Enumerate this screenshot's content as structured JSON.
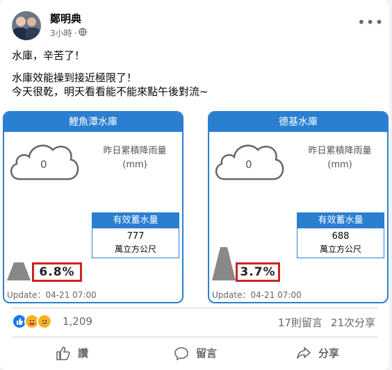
{
  "post": {
    "author": "鄭明典",
    "time": "3小時",
    "dot": "·",
    "privacy_icon": "globe-icon",
    "more_icon": "more-icon",
    "lines": [
      "水庫，辛苦了！",
      "水庫效能操到接近極限了！",
      "今天很乾，明天看看能不能來點午後對流~"
    ]
  },
  "panels": [
    {
      "title": "鯉魚潭水庫",
      "rain_value": "0",
      "rain_label": "昨日累積降雨量",
      "rain_unit": "(mm)",
      "storage_label": "有效蓄水量",
      "storage_value": "777",
      "storage_unit": "萬立方公尺",
      "percent": "6.8%",
      "percent_value": 6.8,
      "update": "Update：04-21 07:00"
    },
    {
      "title": "德基水庫",
      "rain_value": "0",
      "rain_label": "昨日累積降雨量",
      "rain_unit": "(mm)",
      "storage_label": "有效蓄水量",
      "storage_value": "688",
      "storage_unit": "萬立方公尺",
      "percent": "3.7%",
      "percent_value": 3.7,
      "update": "Update：04-21 07:00"
    }
  ],
  "engagement": {
    "reactions": [
      "like",
      "care",
      "sad"
    ],
    "reaction_count": "1,209",
    "comments": "17則留言",
    "shares": "21次分享"
  },
  "actions": {
    "like": "讚",
    "comment": "留言",
    "share": "分享"
  },
  "colors": {
    "panel_blue": "#2a7fd0",
    "highlight_red": "#d32020",
    "like_blue": "#1877f2"
  }
}
